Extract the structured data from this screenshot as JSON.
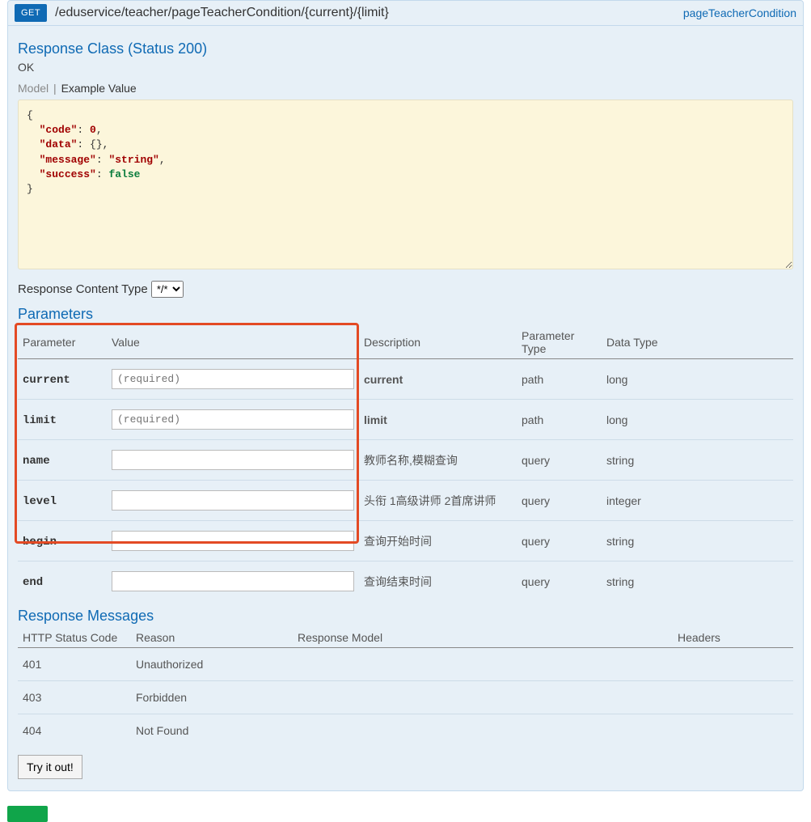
{
  "operation": {
    "method": "GET",
    "path": "/eduservice/teacher/pageTeacherCondition/{current}/{limit}",
    "nickname": "pageTeacherCondition"
  },
  "response_class_title": "Response Class (Status 200)",
  "ok_label": "OK",
  "tabs": {
    "model": "Model",
    "example": "Example Value"
  },
  "example_json": {
    "line1_key": "\"code\"",
    "line1_val": "0",
    "line2_key": "\"data\"",
    "line3_key": "\"message\"",
    "line3_val": "\"string\"",
    "line4_key": "\"success\"",
    "line4_val": "false"
  },
  "content_type": {
    "label": "Response Content Type",
    "selected": "*/*"
  },
  "parameters_title": "Parameters",
  "param_headers": {
    "param": "Parameter",
    "value": "Value",
    "desc": "Description",
    "ptype": "Parameter Type",
    "dtype": "Data Type"
  },
  "parameters": [
    {
      "name": "current",
      "placeholder": "(required)",
      "desc": "current",
      "ptype": "path",
      "dtype": "long"
    },
    {
      "name": "limit",
      "placeholder": "(required)",
      "desc": "limit",
      "ptype": "path",
      "dtype": "long"
    },
    {
      "name": "name",
      "placeholder": "",
      "desc": "教师名称,模糊查询",
      "ptype": "query",
      "dtype": "string"
    },
    {
      "name": "level",
      "placeholder": "",
      "desc": "头衔 1高级讲师 2首席讲师",
      "ptype": "query",
      "dtype": "integer"
    },
    {
      "name": "begin",
      "placeholder": "",
      "desc": "查询开始时间",
      "ptype": "query",
      "dtype": "string"
    },
    {
      "name": "end",
      "placeholder": "",
      "desc": "查询结束时间",
      "ptype": "query",
      "dtype": "string"
    }
  ],
  "response_messages_title": "Response Messages",
  "rm_headers": {
    "status": "HTTP Status Code",
    "reason": "Reason",
    "model": "Response Model",
    "headers": "Headers"
  },
  "response_messages": [
    {
      "status": "401",
      "reason": "Unauthorized"
    },
    {
      "status": "403",
      "reason": "Forbidden"
    },
    {
      "status": "404",
      "reason": "Not Found"
    }
  ],
  "try_button": "Try it out!"
}
